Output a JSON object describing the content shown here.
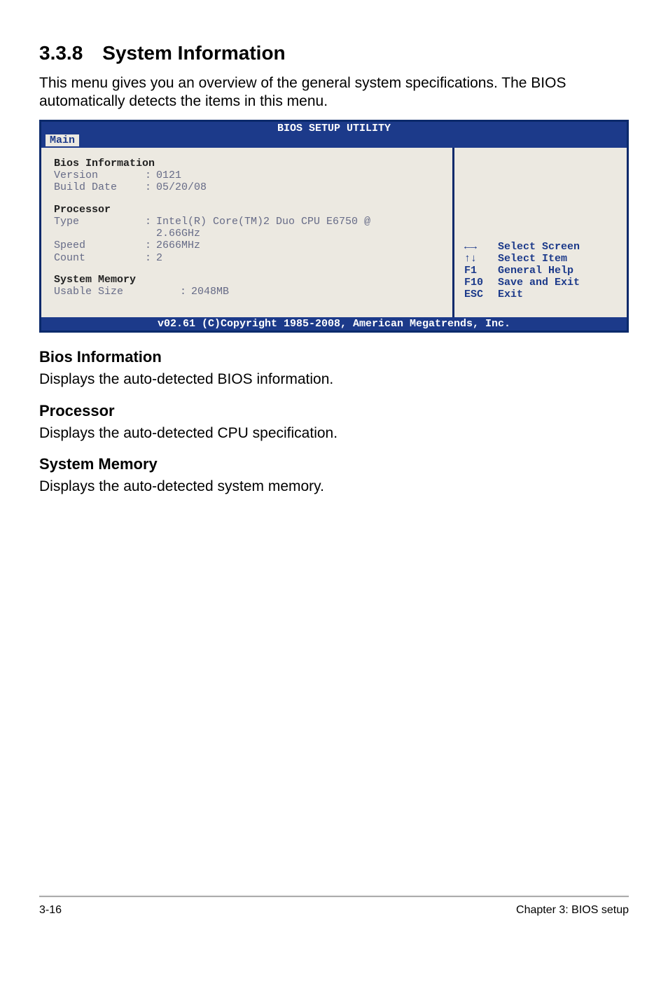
{
  "heading": {
    "number": "3.3.8",
    "title": "System Information"
  },
  "intro": "This menu gives you an overview of the general system specifications. The BIOS automatically detects the items in this menu.",
  "bios": {
    "title": "BIOS SETUP UTILITY",
    "tab": "Main",
    "info_header": "Bios Information",
    "version_label": "Version",
    "version_value": "0121",
    "build_label": "Build Date",
    "build_value": "05/20/08",
    "processor_header": "Processor",
    "proc_type_label": "Type",
    "proc_type_value1": "Intel(R) Core(TM)2 Duo CPU E6750 @",
    "proc_type_value2": "2.66GHz",
    "proc_speed_label": "Speed",
    "proc_speed_value": "2666MHz",
    "proc_count_label": "Count",
    "proc_count_value": "2",
    "mem_header": "System Memory",
    "mem_size_label": "Usable Size",
    "mem_size_value": "2048MB",
    "legend": {
      "select_screen_icon": "←→",
      "select_screen": "Select Screen",
      "select_item_icon": "↑↓",
      "select_item": "Select Item",
      "f1": "F1",
      "f1_text": "General Help",
      "f10": "F10",
      "f10_text": "Save and Exit",
      "esc": "ESC",
      "esc_text": "Exit"
    },
    "footer": "v02.61 (C)Copyright 1985-2008, American Megatrends, Inc."
  },
  "sections": {
    "bios_info_h": "Bios Information",
    "bios_info_p": "Displays the auto-detected BIOS information.",
    "proc_h": "Processor",
    "proc_p": "Displays the auto-detected CPU specification.",
    "mem_h": "System Memory",
    "mem_p": "Displays the auto-detected system memory."
  },
  "footer": {
    "left": "3-16",
    "right": "Chapter 3: BIOS setup"
  }
}
